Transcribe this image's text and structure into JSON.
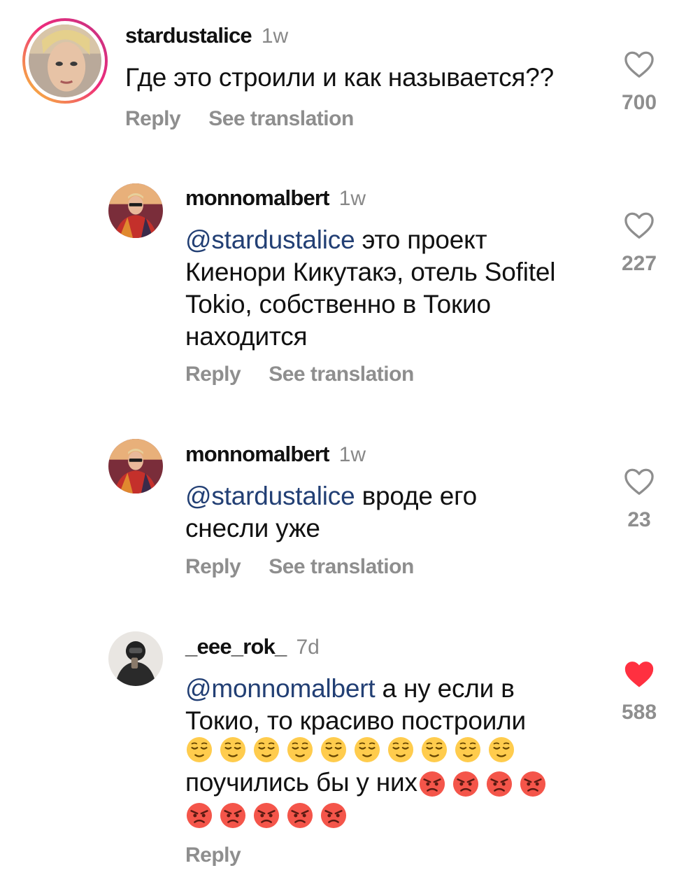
{
  "comments": [
    {
      "username": "stardustalice",
      "time": "1w",
      "text": "Где это строили и как называется??",
      "reply_label": "Reply",
      "translate_label": "See translation",
      "likes": "700",
      "liked": false
    },
    {
      "username": "monnomalbert",
      "time": "1w",
      "mention": "@stardustalice",
      "lines": [
        " это проект",
        "Киенори Кикутакэ, отель Sofitel",
        "Tokio, собственно в Токио",
        "находится"
      ],
      "reply_label": "Reply",
      "translate_label": "See translation",
      "likes": "227",
      "liked": false
    },
    {
      "username": "monnomalbert",
      "time": "1w",
      "mention": "@stardustalice",
      "lines": [
        " вроде его",
        "снесли уже"
      ],
      "reply_label": "Reply",
      "translate_label": "See translation",
      "likes": "23",
      "liked": false
    },
    {
      "username": "_eee_rok_",
      "time": "7d",
      "mention": "@monnomalbert",
      "lines": [
        " а ну если в",
        "Токио, то красиво построили"
      ],
      "emoji_relieved_count": 10,
      "line_after": "поучились бы у них",
      "emoji_angry_inline_count": 4,
      "emoji_angry_next_line_count": 5,
      "reply_label": "Reply",
      "likes": "588",
      "liked": true
    }
  ],
  "colors": {
    "mention": "#223f74",
    "secondary_text": "#8e8e8e",
    "like_active": "#ff3040",
    "story_ring": "#ee2a7b"
  },
  "icons": {
    "like": "heart-outline-icon",
    "like_active": "heart-filled-icon",
    "emoji_1": "relieved-face-emoji",
    "emoji_2": "angry-face-emoji"
  }
}
